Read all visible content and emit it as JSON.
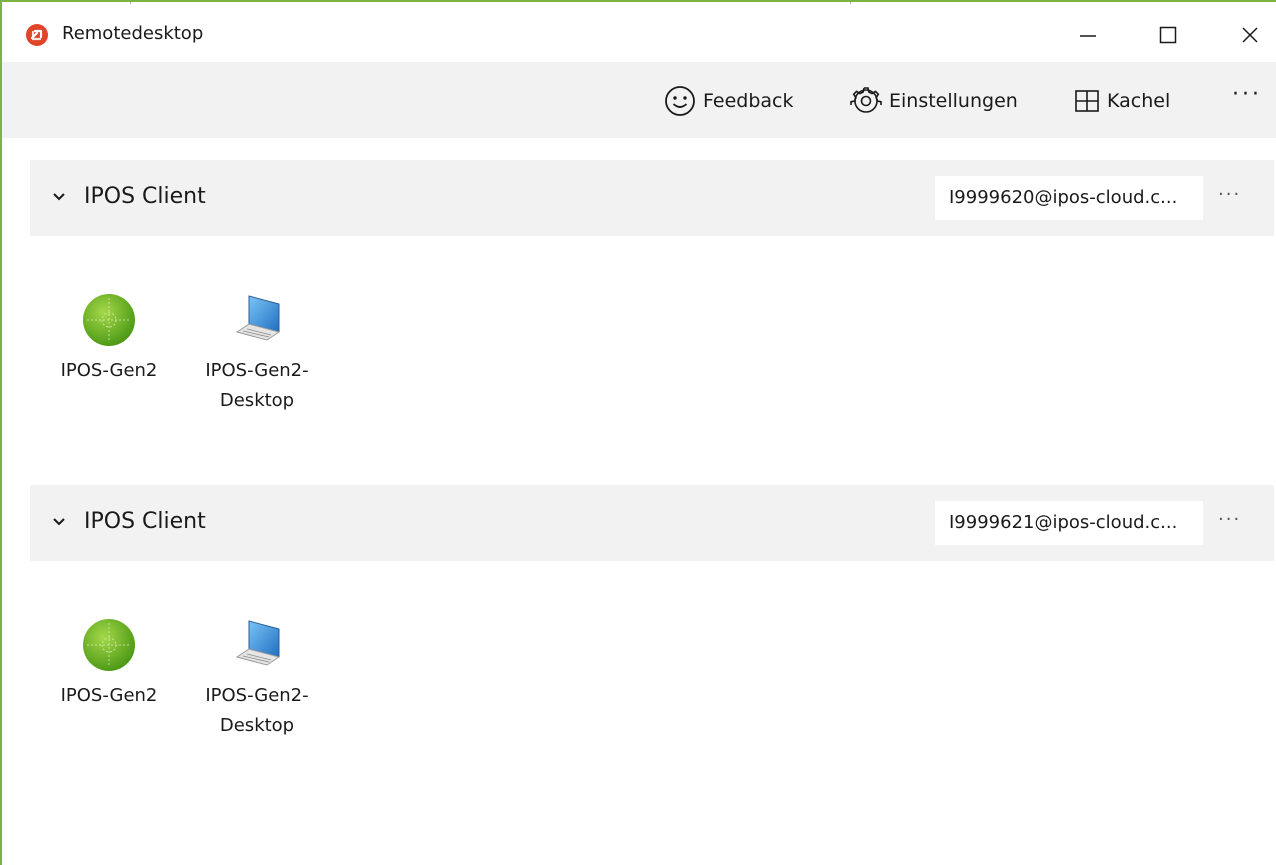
{
  "window": {
    "title": "Remotedesktop"
  },
  "toolbar": {
    "feedback_label": "Feedback",
    "settings_label": "Einstellungen",
    "tile_label": "Kachel",
    "more_label": "···"
  },
  "groups": [
    {
      "title": "IPOS Client",
      "account": "I9999620@ipos-cloud.c...",
      "more_label": "···",
      "items": [
        {
          "label": "IPOS-Gen2",
          "icon": "green-globe-icon"
        },
        {
          "label_line1": "IPOS-Gen2-",
          "label_line2": "Desktop",
          "icon": "laptop-icon"
        }
      ]
    },
    {
      "title": "IPOS Client",
      "account": "I9999621@ipos-cloud.c...",
      "more_label": "···",
      "items": [
        {
          "label": "IPOS-Gen2",
          "icon": "green-globe-icon"
        },
        {
          "label_line1": "IPOS-Gen2-",
          "label_line2": "Desktop",
          "icon": "laptop-icon"
        }
      ]
    }
  ],
  "colors": {
    "accent_border": "#7cb342",
    "app_icon": "#e0452a",
    "toolbar_bg": "#f2f2f2"
  }
}
